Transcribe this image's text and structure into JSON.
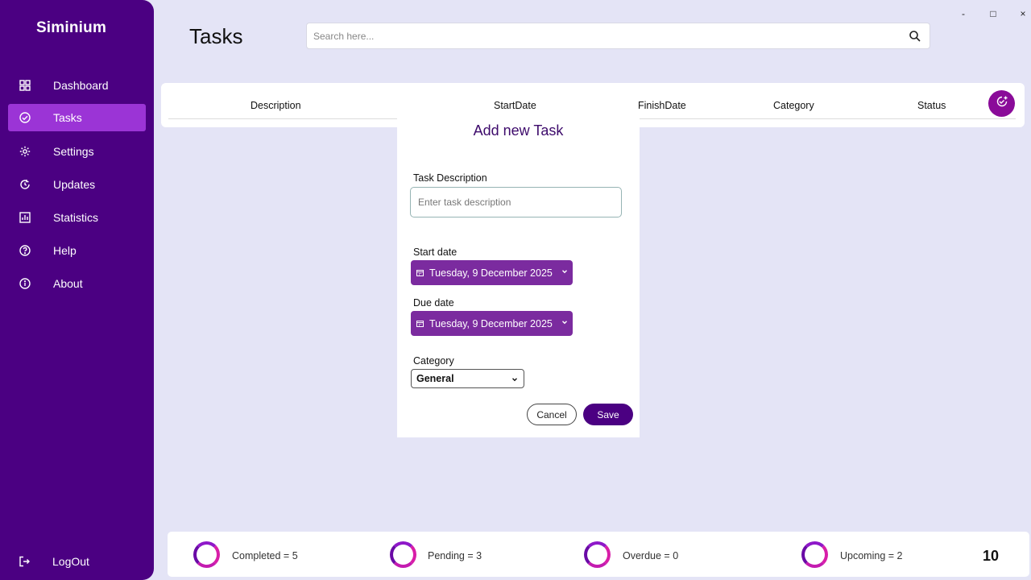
{
  "app": {
    "brand": "Siminium",
    "colors": {
      "sidebar": "#4b0082",
      "active": "#9b34d6",
      "accent": "#8a0b99",
      "datepicker": "#7b2b9f",
      "background": "#e4e4f6"
    }
  },
  "sidebar": {
    "items": [
      {
        "label": "Dashboard",
        "icon": "grid-icon"
      },
      {
        "label": "Tasks",
        "icon": "check-circle-icon",
        "active": true
      },
      {
        "label": "Settings",
        "icon": "gear-icon"
      },
      {
        "label": "Updates",
        "icon": "refresh-icon"
      },
      {
        "label": "Statistics",
        "icon": "chart-icon"
      },
      {
        "label": "Help",
        "icon": "question-icon"
      },
      {
        "label": "About",
        "icon": "info-icon"
      }
    ],
    "logout": {
      "label": "LogOut",
      "icon": "logout-icon"
    }
  },
  "header": {
    "title": "Tasks",
    "search": {
      "placeholder": "Search here...",
      "value": "",
      "icon": "search-icon"
    }
  },
  "window_controls": {
    "minimize": "-",
    "maximize": "□",
    "close": "×"
  },
  "table": {
    "columns": [
      "Description",
      "StartDate",
      "FinishDate",
      "Category",
      "Status"
    ],
    "add_icon": "add-task-icon"
  },
  "dialog": {
    "title": "Add new Task",
    "description_label": "Task Description",
    "description_placeholder": "Enter task description",
    "description_value": "",
    "start_label": "Start date",
    "start_value": "Tuesday, 9 December 2025",
    "due_label": "Due date",
    "due_value": "Tuesday, 9 December 2025",
    "category_label": "Category",
    "category_value": "General",
    "cancel_label": "Cancel",
    "save_label": "Save"
  },
  "status_bar": {
    "stats": [
      {
        "label": "Completed = 5"
      },
      {
        "label": "Pending = 3"
      },
      {
        "label": "Overdue = 0"
      },
      {
        "label": "Upcoming = 2"
      }
    ],
    "total": "10"
  }
}
